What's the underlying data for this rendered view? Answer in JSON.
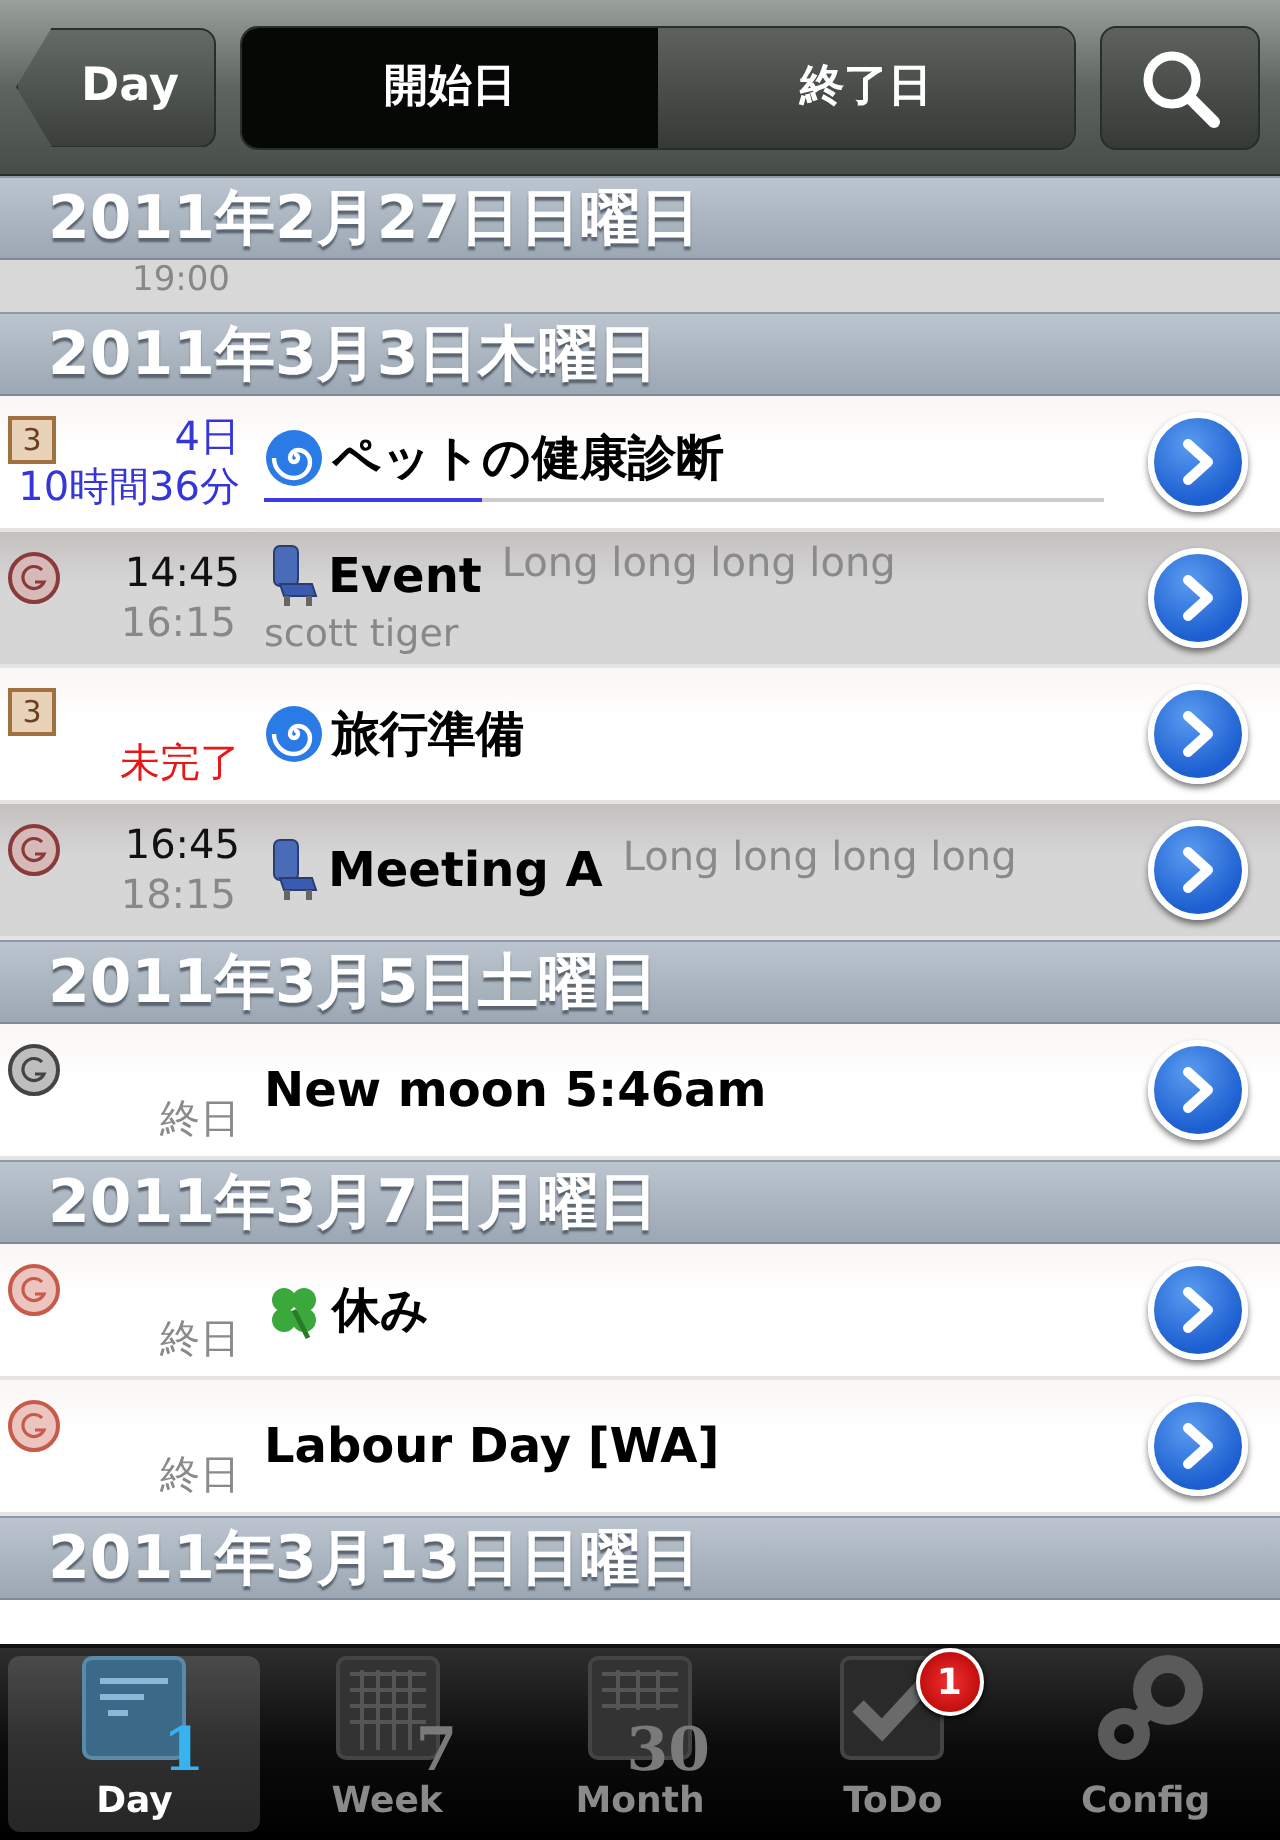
{
  "nav": {
    "back": "Day",
    "segments": [
      {
        "label": "開始日",
        "selected": true
      },
      {
        "label": "終了日",
        "selected": false
      }
    ]
  },
  "peek": {
    "time": "19:00"
  },
  "sections": [
    {
      "header": "2011年2月27日日曜日"
    },
    {
      "header": "2011年3月3日木曜日",
      "events": [
        {
          "kind": "todo",
          "priority": "3",
          "overdue": false,
          "times": [
            "4日",
            "10時間36分"
          ],
          "icon": {
            "kind": "spiral"
          },
          "title": "ペットの健康診断",
          "level": 0.26,
          "shaded": false
        },
        {
          "kind": "timed",
          "color": "#8b3a3a",
          "times": [
            "14:45",
            "16:15"
          ],
          "icon": {
            "kind": "seat"
          },
          "title": "Event",
          "note": "Long long long long",
          "subtitle": "scott tiger",
          "shaded": true
        },
        {
          "kind": "todo",
          "priority": "3",
          "overdue": true,
          "times": [
            "未完了"
          ],
          "icon": {
            "kind": "spiral"
          },
          "title": "旅行準備",
          "shaded": false
        },
        {
          "kind": "timed",
          "color": "#8b3a3a",
          "times": [
            "16:45",
            "18:15"
          ],
          "icon": {
            "kind": "seat"
          },
          "title": "Meeting A",
          "note": "Long long long long",
          "shaded": true
        }
      ]
    },
    {
      "header": "2011年3月5日土曜日",
      "events": [
        {
          "kind": "allday",
          "color": "#444444",
          "times": [
            "終日"
          ],
          "title": "New moon 5:46am",
          "shaded": false
        }
      ]
    },
    {
      "header": "2011年3月7日月曜日",
      "events": [
        {
          "kind": "allday",
          "color": "#c85a4a",
          "times": [
            "終日"
          ],
          "icon": {
            "kind": "clover"
          },
          "title": "休み",
          "shaded": false
        },
        {
          "kind": "allday",
          "color": "#c85a4a",
          "times": [
            "終日"
          ],
          "title": "Labour Day [WA]",
          "shaded": false
        }
      ]
    },
    {
      "header": "2011年3月13日日曜日"
    }
  ],
  "tabs": [
    {
      "label": "Day",
      "kind": "day",
      "number": "1",
      "selected": true
    },
    {
      "label": "Week",
      "kind": "week",
      "number": "7",
      "selected": false
    },
    {
      "label": "Month",
      "kind": "month",
      "number": "30",
      "selected": false
    },
    {
      "label": "ToDo",
      "kind": "todo",
      "badge": "1",
      "selected": false
    },
    {
      "label": "Config",
      "kind": "config",
      "selected": false
    }
  ]
}
